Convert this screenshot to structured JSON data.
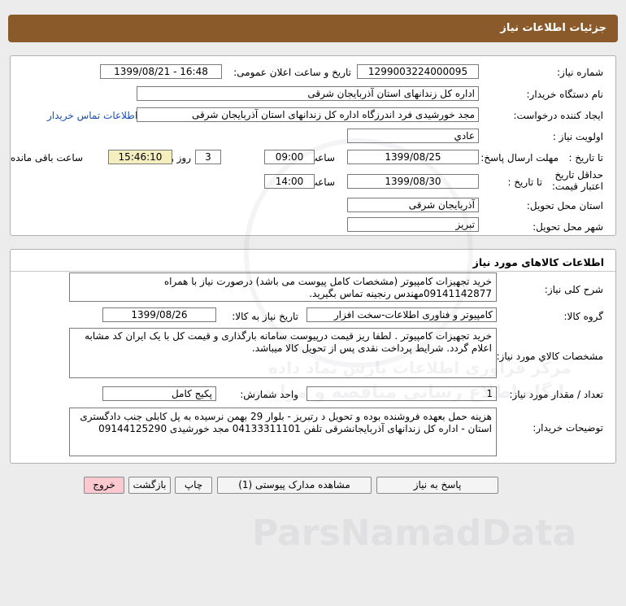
{
  "header": {
    "title": "جزئیات اطلاعات نیاز"
  },
  "info": {
    "need_number_label": "شماره نیاز:",
    "need_number": "1299003224000095",
    "announce_label": "تاریخ و ساعت اعلان عمومی:",
    "announce_value": "1399/08/21 - 16:48",
    "buyer_org_label": "نام دستگاه خریدار:",
    "buyer_org": "اداره کل زندانهای استان آذربایجان شرقی",
    "requester_label": "ایجاد کننده درخواست:",
    "requester": "مجد خورشیدی فرد اندرزگاه اداره کل زندانهای استان آذربایجان شرقی",
    "contact_link": "اطلاعات تماس خریدار",
    "priority_label": "اولویت نیاز :",
    "priority": "عادي",
    "deadline_label": "مهلت ارسال پاسخ:",
    "to_date_label": "تا تاریخ :",
    "deadline_date": "1399/08/25",
    "time_label": "ساعت",
    "deadline_time": "09:00",
    "days_value": "3",
    "days_label": "روز و",
    "remaining_time": "15:46:10",
    "remaining_label": "ساعت باقی مانده",
    "validity_label": "حداقل تاریخ اعتبار قیمت:",
    "validity_to_label": "تا تاریخ :",
    "validity_date": "1399/08/30",
    "validity_time_label": "ساعت",
    "validity_time": "14:00",
    "province_label": "استان محل تحویل:",
    "province": "آذربایجان شرقی",
    "city_label": "شهر محل تحویل:",
    "city": "تبریز"
  },
  "goods": {
    "section_title": "اطلاعات کالاهای مورد نیاز",
    "desc_label": "شرح کلی نیاز:",
    "desc": "خرید تجهیزات کامپیوتر (مشخصات کامل پیوست می باشد) درصورت نیاز با همراه 09141142877مهندس رنجینه  تماس بگیرید.",
    "group_label": "گروه کالا:",
    "group": "کامپیوتر و فناوری اطلاعات-سخت افزار",
    "need_date_label": "تاریخ نیاز به کالا:",
    "need_date": "1399/08/26",
    "spec_label": "مشخصات کالاي مورد نياز:",
    "spec": "خرید تجهیزات کامپیوتر . لطفا ریز قیمت درپیوست سامانه بارگذاری و قیمت کل با یک ایران کد مشابه اعلام گردد. شرایط پرداخت نقدی پس از تحویل کالا میباشد.",
    "qty_label": "تعداد / مقدار مورد نیاز:",
    "qty": "1",
    "unit_label": "واحد شمارش:",
    "unit": "پکیج کامل",
    "buyer_notes_label": "توضیحات خریدار:",
    "buyer_notes": "هزینه حمل بعهده فروشنده بوده و تحویل د رتبریز - بلوار 29 بهمن نرسیده به پل کابلی جنب دادگستری استان - اداره کل زندانهای آذربایجانشرقی تلفن 04133311101 مجد خورشیدی 09144125290"
  },
  "buttons": {
    "reply": "پاسخ به نیاز",
    "attachments": "مشاهده مدارک پیوستی (1)",
    "print": "چاپ",
    "back": "بازگشت",
    "exit": "خروج"
  },
  "watermark": {
    "line1": "مرکز فراوری اطلاعات پارس نماد داده",
    "line2": "پایگاه اطلاع رسانی مناقصه و مزایده",
    "line3": "ParsNamadData"
  }
}
